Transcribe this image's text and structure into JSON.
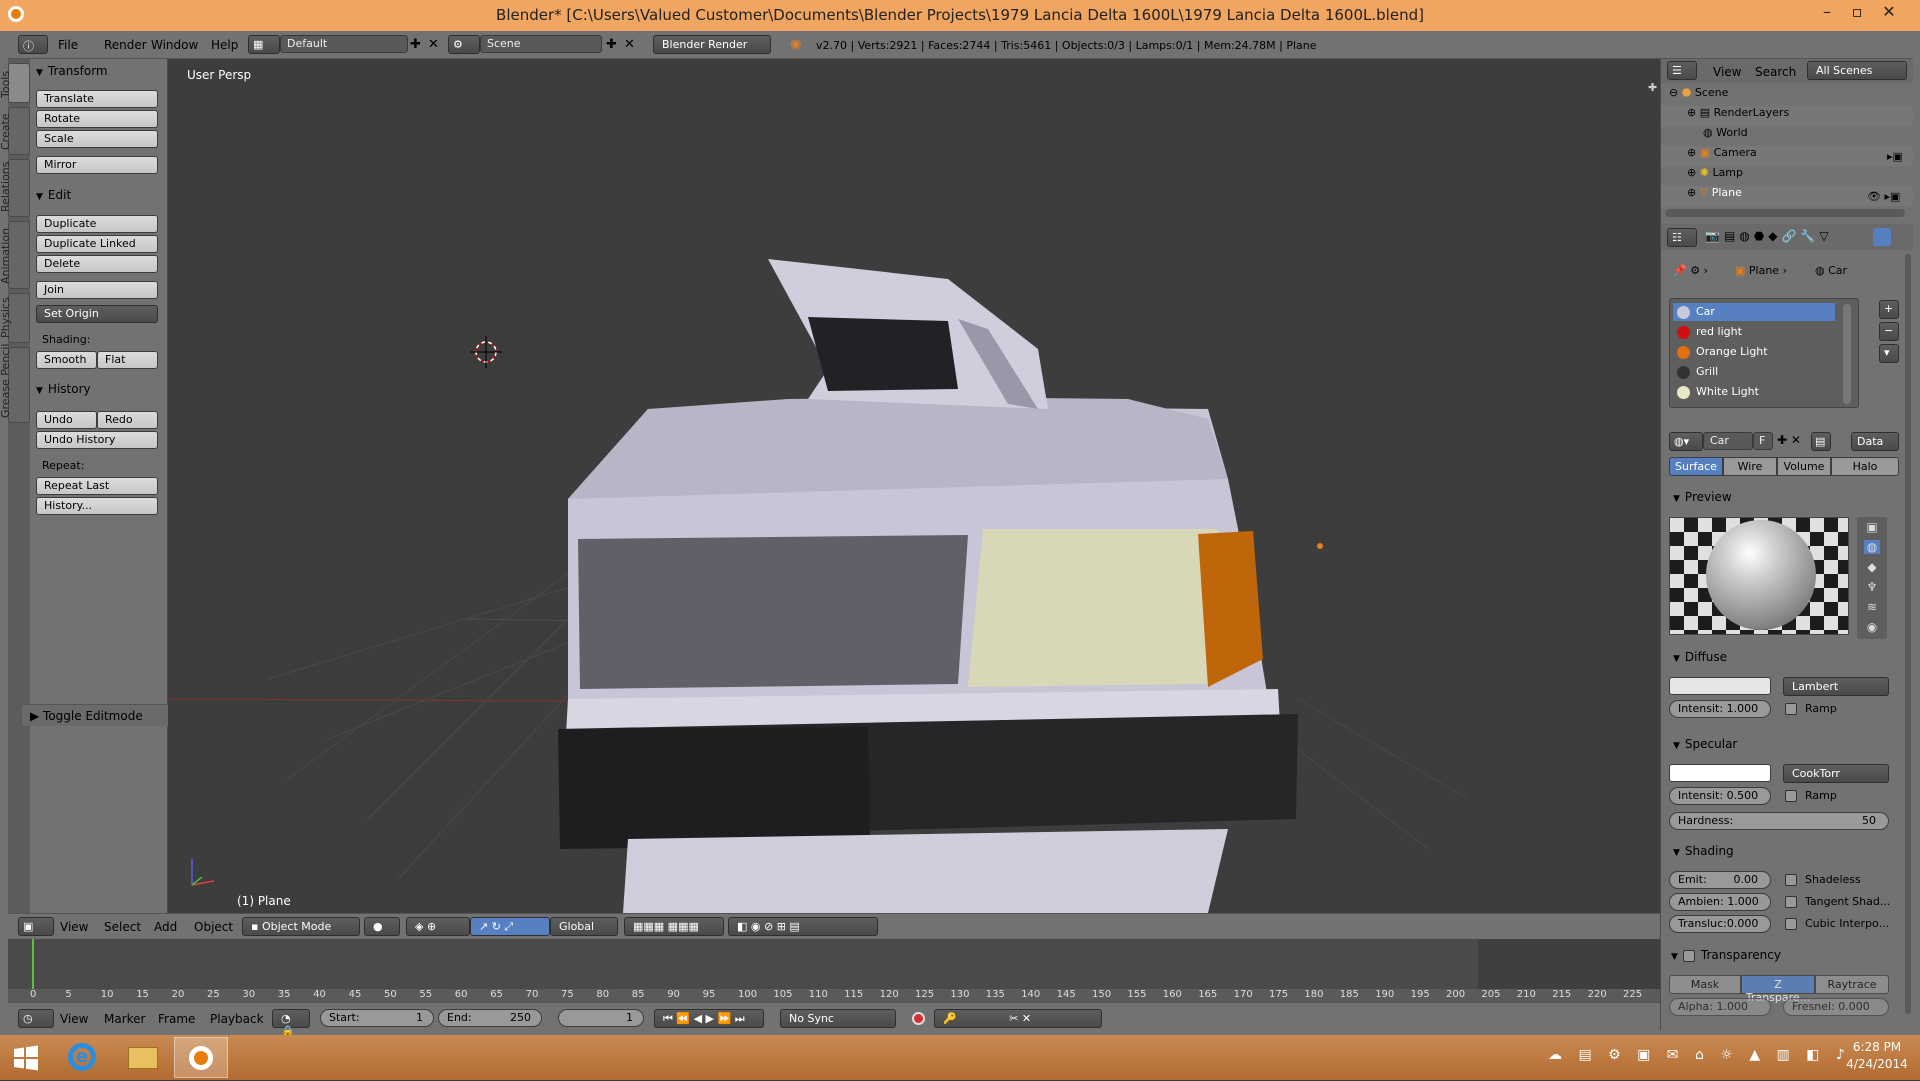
{
  "window": {
    "title": "Blender* [C:\\Users\\Valued Customer\\Documents\\Blender Projects\\1979 Lancia Delta 1600L\\1979 Lancia Delta 1600L.blend]"
  },
  "info_header": {
    "menu": [
      "File",
      "Render",
      "Window",
      "Help"
    ],
    "layout": "Default",
    "scene": "Scene",
    "engine": "Blender Render",
    "stats": "v2.70 | Verts:2921 | Faces:2744 | Tris:5461 | Objects:0/3 | Lamps:0/1 | Mem:24.78M | Plane"
  },
  "tool_tabs": [
    "Tools",
    "Create",
    "Relations",
    "Animation",
    "Physics",
    "Grease Pencil"
  ],
  "toolshelf": {
    "transform": {
      "title": "Transform",
      "buttons": [
        "Translate",
        "Rotate",
        "Scale",
        "Mirror"
      ]
    },
    "edit": {
      "title": "Edit",
      "buttons": [
        "Duplicate",
        "Duplicate Linked",
        "Delete",
        "Join"
      ],
      "set_origin": "Set Origin",
      "shading_label": "Shading:",
      "smooth": "Smooth",
      "flat": "Flat"
    },
    "history": {
      "title": "History",
      "undo": "Undo",
      "redo": "Redo",
      "undo_history": "Undo History",
      "repeat_label": "Repeat:",
      "repeat_last": "Repeat Last",
      "history_btn": "History..."
    },
    "toggle_editmode": "Toggle Editmode"
  },
  "viewport": {
    "view_name": "User Persp",
    "object_label": "(1) Plane"
  },
  "view3d_header": {
    "menu": [
      "View",
      "Select",
      "Add",
      "Object"
    ],
    "mode": "Object Mode",
    "orientation": "Global"
  },
  "timeline": {
    "ticks": [
      "0",
      "5",
      "10",
      "15",
      "20",
      "25",
      "30",
      "35",
      "40",
      "45",
      "50",
      "55",
      "60",
      "65",
      "70",
      "75",
      "80",
      "85",
      "90",
      "95",
      "100",
      "105",
      "110",
      "115",
      "120",
      "125",
      "130",
      "135",
      "140",
      "145",
      "150",
      "155",
      "160",
      "165",
      "170",
      "175",
      "180",
      "185",
      "190",
      "195",
      "200",
      "205",
      "210",
      "215",
      "220",
      "225"
    ],
    "menu": [
      "View",
      "Marker",
      "Frame",
      "Playback"
    ],
    "start": "Start:",
    "start_val": "1",
    "end": "End:",
    "end_val": "250",
    "current": "1",
    "sync": "No Sync"
  },
  "outliner": {
    "menu": [
      "View",
      "Search"
    ],
    "filter": "All Scenes",
    "items": [
      "Scene",
      "RenderLayers",
      "World",
      "Camera",
      "Lamp",
      "Plane"
    ]
  },
  "properties": {
    "breadcrumb_obj": "Plane",
    "breadcrumb_mat": "Car",
    "materials": [
      {
        "name": "Car",
        "color": "#c8c8d8"
      },
      {
        "name": "red light",
        "color": "#d01010"
      },
      {
        "name": "Orange Light",
        "color": "#e07010"
      },
      {
        "name": "Grill",
        "color": "#333333"
      },
      {
        "name": "White Light",
        "color": "#e8e8c8"
      }
    ],
    "mat_name": "Car",
    "mat_f": "F",
    "mat_data": "Data",
    "tabs": [
      "Surface",
      "Wire",
      "Volume",
      "Halo"
    ],
    "preview_title": "Preview",
    "diffuse": {
      "title": "Diffuse",
      "shader": "Lambert",
      "intensity": "Intensit: 1.000",
      "ramp": "Ramp"
    },
    "specular": {
      "title": "Specular",
      "shader": "CookTorr",
      "intensity_label": "Intensit:",
      "intensity_val": "0.500",
      "ramp": "Ramp",
      "hardness_label": "Hardness:",
      "hardness_val": "50"
    },
    "shading": {
      "title": "Shading",
      "emit_label": "Emit:",
      "emit_val": "0.00",
      "ambient": "Ambien: 1.000",
      "transluc": "Transluc:0.000",
      "shadeless": "Shadeless",
      "tangent": "Tangent Shad...",
      "cubic": "Cubic Interpo..."
    },
    "transparency": {
      "title": "Transparency",
      "tabs": [
        "Mask",
        "Z Transpare...",
        "Raytrace"
      ],
      "alpha": "Alpha: 1.000",
      "fresnel": "Fresnel: 0.000"
    }
  },
  "taskbar": {
    "time": "6:28 PM",
    "date": "4/24/2014"
  },
  "colors": {
    "accent": "#5680c2",
    "title_bar": "#f0a560"
  }
}
